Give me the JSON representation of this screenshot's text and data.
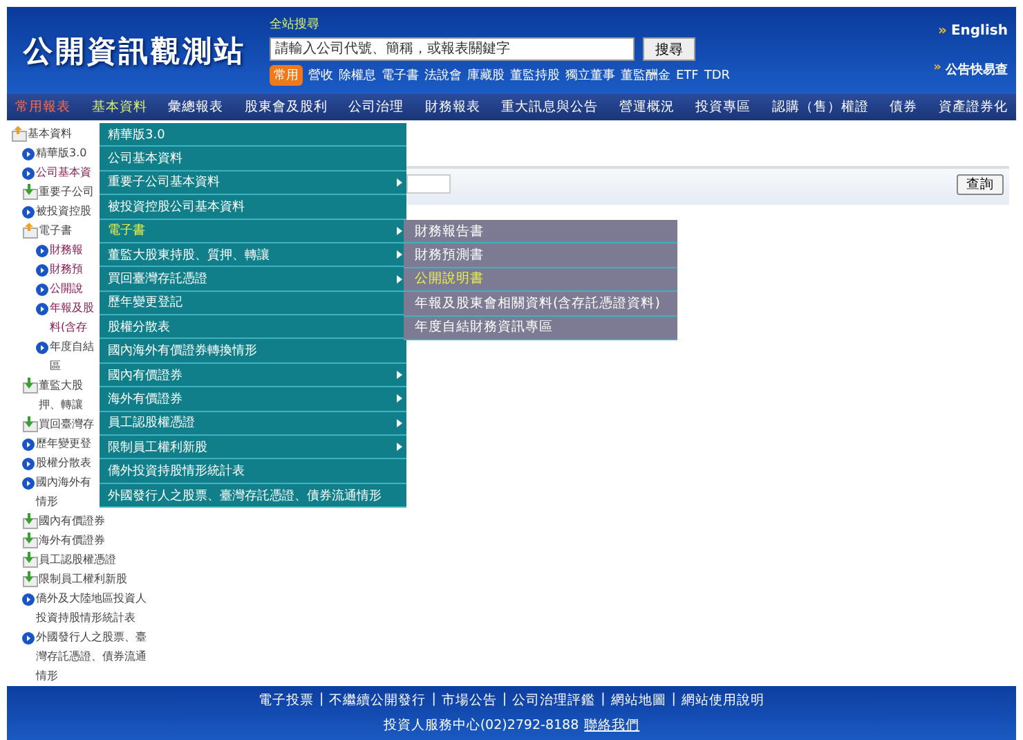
{
  "header": {
    "logo": "公開資訊觀測站",
    "search_label": "全站搜尋",
    "search": {
      "placeholder": "請輸入公司代號、簡稱，或報表關鍵字"
    },
    "search_button": "搜尋",
    "quick_badge": "常用",
    "quick_links": [
      "營收",
      "除權息",
      "電子書",
      "法說會",
      "庫藏股",
      "董監持股",
      "獨立董事",
      "董監酬金",
      "ETF",
      "TDR"
    ],
    "right_links": [
      {
        "icon": "»",
        "label": "English",
        "kind": "bold"
      },
      {
        "icon": "»",
        "label": "公告快易查",
        "kind": "normal"
      }
    ]
  },
  "nav": [
    {
      "label": "常用報表",
      "selected": false,
      "kind": "hot"
    },
    {
      "label": "基本資料",
      "selected": true,
      "kind": "normal"
    },
    {
      "label": "彙總報表",
      "selected": false,
      "kind": "normal"
    },
    {
      "label": "股東會及股利",
      "selected": false,
      "kind": "normal"
    },
    {
      "label": "公司治理",
      "selected": false,
      "kind": "normal"
    },
    {
      "label": "財務報表",
      "selected": false,
      "kind": "normal"
    },
    {
      "label": "重大訊息與公告",
      "selected": false,
      "kind": "normal"
    },
    {
      "label": "營運概況",
      "selected": false,
      "kind": "normal"
    },
    {
      "label": "投資專區",
      "selected": false,
      "kind": "normal"
    },
    {
      "label": "認購（售）權證",
      "selected": false,
      "kind": "normal"
    },
    {
      "label": "債券",
      "selected": false,
      "kind": "normal"
    },
    {
      "label": "資產證券化",
      "selected": false,
      "kind": "normal"
    }
  ],
  "tree": {
    "label": "基本資料",
    "children": [
      {
        "kind": "leaf",
        "lines": [
          "精華版3.0"
        ],
        "visited": false
      },
      {
        "kind": "leaf",
        "lines": [
          "公司基本資"
        ],
        "visited": true
      },
      {
        "kind": "folder",
        "lines": [
          "重要子公司"
        ],
        "expanded": false,
        "visited": false
      },
      {
        "kind": "leaf",
        "lines": [
          "被投資控股"
        ],
        "visited": false
      },
      {
        "kind": "folder",
        "lines": [
          "電子書"
        ],
        "expanded": true,
        "visited": false,
        "children": [
          {
            "kind": "leaf",
            "lines": [
              "財務報"
            ],
            "visited": true
          },
          {
            "kind": "leaf",
            "lines": [
              "財務預"
            ],
            "visited": true
          },
          {
            "kind": "leaf",
            "lines": [
              "公開說"
            ],
            "visited": true
          },
          {
            "kind": "leaf",
            "lines": [
              "年報及股",
              "料(含存"
            ],
            "visited": true
          },
          {
            "kind": "leaf",
            "lines": [
              "年度自結",
              "區"
            ],
            "visited": false
          }
        ]
      },
      {
        "kind": "folder",
        "lines": [
          "董監大股",
          "押、轉讓"
        ],
        "expanded": false,
        "visited": false
      },
      {
        "kind": "folder",
        "lines": [
          "買回臺灣存"
        ],
        "expanded": false,
        "visited": false
      },
      {
        "kind": "leaf",
        "lines": [
          "歷年變更登"
        ],
        "visited": false
      },
      {
        "kind": "leaf",
        "lines": [
          "股權分散表"
        ],
        "visited": false
      },
      {
        "kind": "leaf",
        "lines": [
          "國內海外有",
          "情形"
        ],
        "visited": false
      },
      {
        "kind": "folder",
        "lines": [
          "國內有價證券"
        ],
        "expanded": false,
        "visited": false
      },
      {
        "kind": "folder",
        "lines": [
          "海外有價證券"
        ],
        "expanded": false,
        "visited": false
      },
      {
        "kind": "folder",
        "lines": [
          "員工認股權憑證"
        ],
        "expanded": false,
        "visited": false
      },
      {
        "kind": "folder",
        "lines": [
          "限制員工權利新股"
        ],
        "expanded": false,
        "visited": false
      },
      {
        "kind": "leaf",
        "lines": [
          "僑外及大陸地區投資人",
          "投資持股情形統計表"
        ],
        "visited": false
      },
      {
        "kind": "leaf",
        "lines": [
          "外國發行人之股票、臺",
          "灣存託憑證、債券流通",
          "情形"
        ],
        "visited": false
      }
    ]
  },
  "query_button": "查詢",
  "menu": [
    {
      "label": "精華版3.0",
      "selected": false,
      "has_submenu": false
    },
    {
      "label": "公司基本資料",
      "selected": false,
      "has_submenu": false
    },
    {
      "label": "重要子公司基本資料",
      "selected": false,
      "has_submenu": true
    },
    {
      "label": "被投資控股公司基本資料",
      "selected": false,
      "has_submenu": false
    },
    {
      "label": "電子書",
      "selected": true,
      "has_submenu": true
    },
    {
      "label": "董監大股東持股、質押、轉讓",
      "selected": false,
      "has_submenu": true
    },
    {
      "label": "買回臺灣存託憑證",
      "selected": false,
      "has_submenu": true
    },
    {
      "label": "歷年變更登記",
      "selected": false,
      "has_submenu": false
    },
    {
      "label": "股權分散表",
      "selected": false,
      "has_submenu": false
    },
    {
      "label": "國內海外有價證券轉換情形",
      "selected": false,
      "has_submenu": false
    },
    {
      "label": "國內有價證券",
      "selected": false,
      "has_submenu": true
    },
    {
      "label": "海外有價證券",
      "selected": false,
      "has_submenu": true
    },
    {
      "label": "員工認股權憑證",
      "selected": false,
      "has_submenu": true
    },
    {
      "label": "限制員工權利新股",
      "selected": false,
      "has_submenu": true
    },
    {
      "label": "僑外投資持股情形統計表",
      "selected": false,
      "has_submenu": false
    },
    {
      "label": "外國發行人之股票、臺灣存託憑證、債券流通情形",
      "selected": false,
      "has_submenu": false
    }
  ],
  "submenu": [
    {
      "label": "財務報告書",
      "selected": false
    },
    {
      "label": "財務預測書",
      "selected": false
    },
    {
      "label": "公開說明書",
      "selected": true
    },
    {
      "label": "年報及股東會相關資料(含存託憑證資料)",
      "selected": false
    },
    {
      "label": "年度自結財務資訊專區",
      "selected": false
    }
  ],
  "footer": {
    "links": [
      "電子投票",
      "不繼續公開發行",
      "市場公告",
      "公司治理評鑑",
      "網站地圖",
      "網站使用說明"
    ],
    "separator": "|",
    "contact": "投資人服務中心(02)2792-8188",
    "contact_link": "聯絡我們"
  }
}
